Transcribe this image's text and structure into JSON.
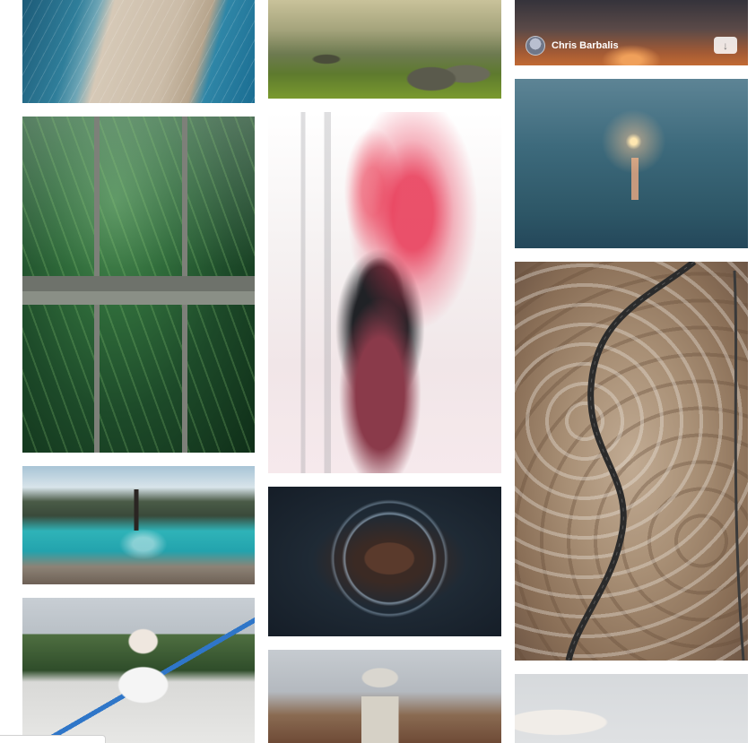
{
  "gallery": {
    "photos": [
      {
        "id": "beach",
        "icon": "beach-aerial-photo"
      },
      {
        "id": "mountains",
        "icon": "mountain-rocks-photo"
      },
      {
        "id": "sunset",
        "icon": "sunset-photo"
      },
      {
        "id": "greenhouse-plants",
        "icon": "greenhouse-plants-photo"
      },
      {
        "id": "red-smoke-flare",
        "icon": "smoke-flare-photo"
      },
      {
        "id": "sparkler-water",
        "icon": "sparkler-in-water-photo"
      },
      {
        "id": "winding-road",
        "icon": "winding-road-aerial-photo"
      },
      {
        "id": "mountain-lake",
        "icon": "mountain-lake-photo"
      },
      {
        "id": "sparkler-portrait",
        "icon": "sparkler-portrait-photo"
      },
      {
        "id": "scooter-kid",
        "icon": "scooter-rider-photo"
      },
      {
        "id": "london-dome",
        "icon": "cathedral-dome-photo"
      },
      {
        "id": "white-fox",
        "icon": "white-animal-photo"
      }
    ],
    "hover_credit": {
      "photographer": "Chris Barbalis",
      "download_icon": "download-arrow-icon"
    }
  },
  "colors": {
    "background": "#ffffff",
    "credit_text": "#ffffff",
    "download_button": "#ffffff"
  }
}
